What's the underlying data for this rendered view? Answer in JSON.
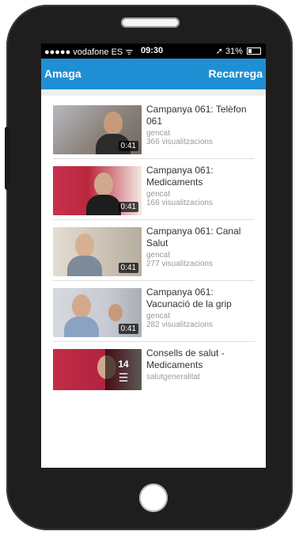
{
  "status_bar": {
    "signal": "●●●●● vodafone ES",
    "wifi_icon": "wifi-icon",
    "time": "09:30",
    "location_icon": "location-arrow-icon",
    "battery": "31%"
  },
  "nav": {
    "left_label": "Amaga",
    "right_label": "Recarrega",
    "color": "#1f8fd3"
  },
  "videos": [
    {
      "title_1": "Campanya 061: Telèfon",
      "title_2": "061",
      "channel": "gencat",
      "views": "366 visualitzacions",
      "duration": "0:41"
    },
    {
      "title_1": "Campanya 061:",
      "title_2": "Medicaments",
      "channel": "gencat",
      "views": "166 visualitzacions",
      "duration": "0:41"
    },
    {
      "title_1": "Campanya 061: Canal",
      "title_2": "Salut",
      "channel": "gencat",
      "views": "277 visualitzacions",
      "duration": "0:41"
    },
    {
      "title_1": "Campanya 061:",
      "title_2": "Vacunació de la grip",
      "channel": "gencat",
      "views": "282 visualitzacions",
      "duration": "0:41"
    },
    {
      "title_1": "Consells de salut -",
      "title_2": "Medicaments",
      "channel": "salutgeneralitat",
      "playlist_count": "14"
    }
  ]
}
